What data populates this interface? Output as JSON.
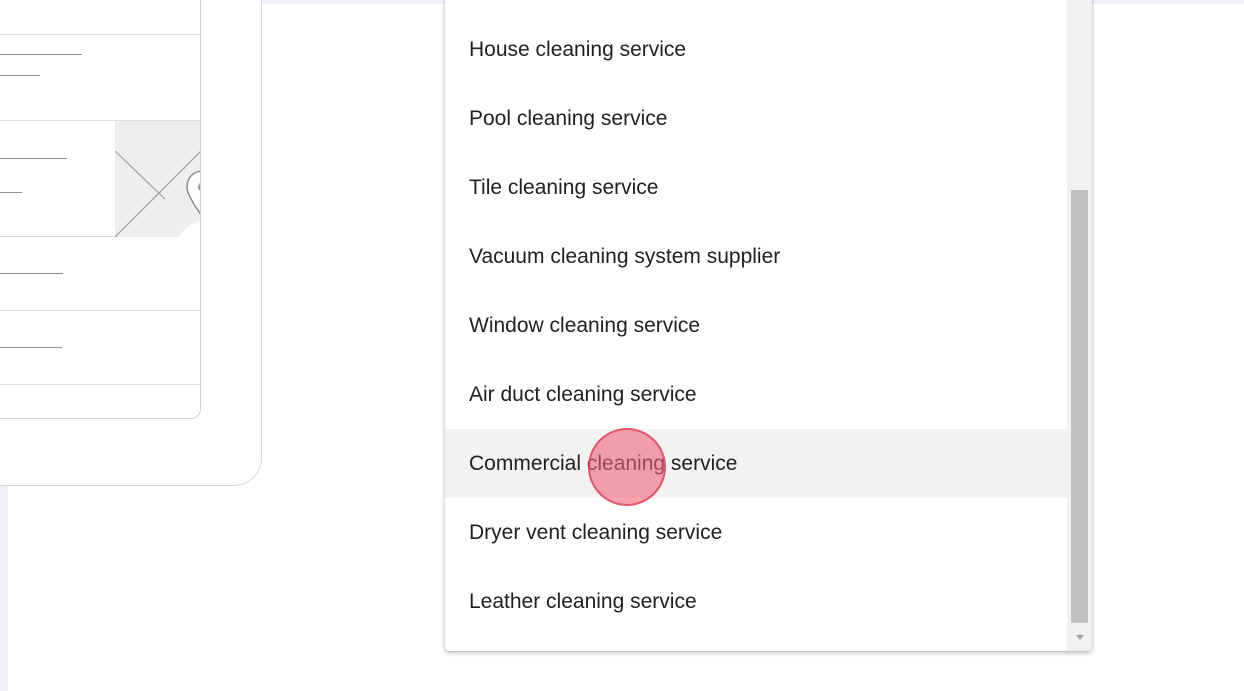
{
  "dropdown": {
    "options": [
      {
        "label": "House cleaning service"
      },
      {
        "label": "Pool cleaning service"
      },
      {
        "label": "Tile cleaning service"
      },
      {
        "label": "Vacuum cleaning system supplier"
      },
      {
        "label": "Window cleaning service"
      },
      {
        "label": "Air duct cleaning service"
      },
      {
        "label": "Commercial cleaning service",
        "highlighted": true
      },
      {
        "label": "Dryer vent cleaning service"
      },
      {
        "label": "Leather cleaning service"
      }
    ]
  },
  "colors": {
    "highlight": "#f2f2f2",
    "click_indicator": "#ee6478",
    "scroll_thumb": "#c1c1c1"
  },
  "icons": [
    "chevron-right-icon",
    "map-pin-icon",
    "scroll-down-arrow-icon"
  ]
}
